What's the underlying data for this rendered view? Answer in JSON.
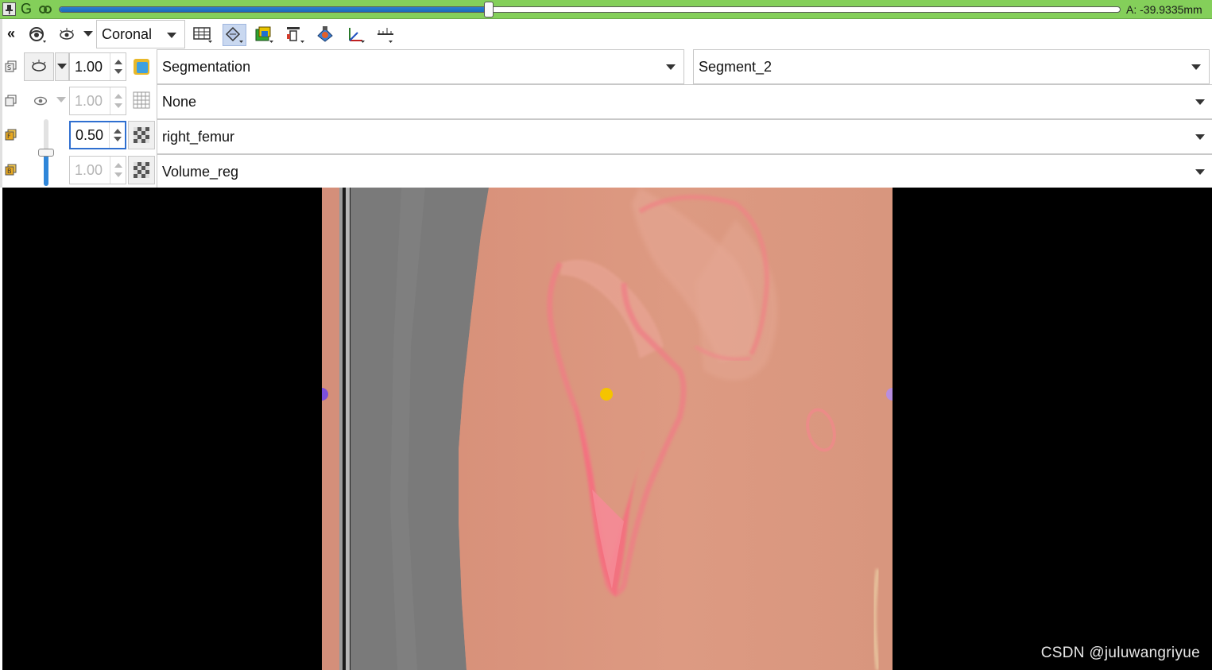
{
  "slice_bar": {
    "view_letter": "G",
    "offset_label": "A: -39.9335mm",
    "slider_position": 0.405,
    "color": "#84cf5a"
  },
  "toolbar": {
    "collapse_label": "«",
    "orientation": "Coronal"
  },
  "layers": {
    "segmentation": {
      "opacity": "1.00",
      "node": "Segmentation",
      "segment": "Segment_2"
    },
    "label": {
      "opacity": "1.00",
      "node": "None"
    },
    "foreground": {
      "opacity": "0.50",
      "node": "right_femur"
    },
    "background": {
      "opacity": "1.00",
      "node": "Volume_reg"
    },
    "fg_bg_slider": 0.5
  },
  "view": {
    "watermark": "CSDN @juluwangriyue",
    "overlay_color": "#d9937a"
  },
  "icons": [
    "pin-icon",
    "link-icon",
    "collapse-icon",
    "eye-icon",
    "slice-visibility-icon",
    "lightbox-icon",
    "reformat-icon",
    "segment-color-icon",
    "layer-icon",
    "model-icon",
    "axes-icon",
    "ruler-icon",
    "grid-icon",
    "checkerboard-icon"
  ]
}
